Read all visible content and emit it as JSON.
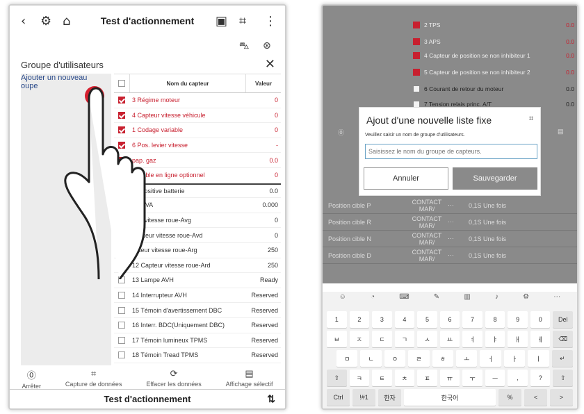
{
  "left_screen": {
    "title": "Test d'actionnement",
    "group_title": "Groupe d'utilisateurs",
    "add_group_link": "Ajouter un nouveau\noupe",
    "table": {
      "col_name": "Nom du capteur",
      "col_value": "Valeur",
      "rows": [
        {
          "name": "3 Régime moteur",
          "value": "0",
          "checked": true
        },
        {
          "name": "4 Capteur vitesse véhicule",
          "value": "0",
          "checked": true
        },
        {
          "name": "1 Codage variable",
          "value": "0",
          "checked": true
        },
        {
          "name": "6 Pos. levier vitesse",
          "value": "-",
          "checked": true
        },
        {
          "name": "pap. gaz",
          "value": "0.0",
          "checked": true
        },
        {
          "name": "variable en ligne optionnel",
          "value": "0",
          "checked": true
        },
        {
          "name": "on positive batterie",
          "value": "0.0",
          "checked": false
        },
        {
          "name": "ion LVA",
          "value": "0.000",
          "checked": false
        },
        {
          "name": "teur vitesse roue-Avg",
          "value": "0",
          "checked": false
        },
        {
          "name": "Capteur vitesse roue-Avd",
          "value": "0",
          "checked": false
        },
        {
          "name": "apteur vitesse roue-Arg",
          "value": "250",
          "checked": false
        },
        {
          "name": "12 Capteur vitesse roue-Ard",
          "value": "250",
          "checked": false
        },
        {
          "name": "13 Lampe AVH",
          "value": "Ready",
          "checked": false
        },
        {
          "name": "14 Interrupteur AVH",
          "value": "Reserved",
          "checked": false
        },
        {
          "name": "15 Témoin d'avertissement DBC",
          "value": "Reserved",
          "checked": false
        },
        {
          "name": "16 Interr. BDC(Uniquement DBC)",
          "value": "Reserved",
          "checked": false
        },
        {
          "name": "17 Témoin lumineux TPMS",
          "value": "Reserved",
          "checked": false
        },
        {
          "name": "18 Témoin Tread TPMS",
          "value": "Reserved",
          "checked": false
        }
      ]
    },
    "tools": [
      {
        "label": "Arrêter",
        "icon": "stop-icon"
      },
      {
        "label": "Capture de données",
        "icon": "capture-icon"
      },
      {
        "label": "Effacer les données",
        "icon": "refresh-icon"
      },
      {
        "label": "Affichage sélectif",
        "icon": "list-icon"
      }
    ],
    "footer_title": "Test d'actionnement"
  },
  "right_screen": {
    "bg_rows": [
      {
        "name": "2 TPS",
        "value": "0.0",
        "checked": true
      },
      {
        "name": "3 APS",
        "value": "0.0",
        "checked": true
      },
      {
        "name": "4 Capteur de position se non inhibiteur 1",
        "value": "0.0",
        "checked": true
      },
      {
        "name": "5 Capteur de position se non inhibiteur 2",
        "value": "0.0",
        "checked": true
      },
      {
        "name": "6 Courant de retour du moteur",
        "value": "0.0",
        "checked": false
      },
      {
        "name": "7 Tension relais princ. A/T",
        "value": "0.0",
        "checked": false
      }
    ],
    "bg_list": [
      {
        "name": "Position cible P",
        "cmd": "CONTACT MAR/",
        "dur": "0,1S Une fois"
      },
      {
        "name": "Position cible R",
        "cmd": "CONTACT MAR/",
        "dur": "0,1S Une fois"
      },
      {
        "name": "Position cible N",
        "cmd": "CONTACT MAR/",
        "dur": "0,1S Une fois"
      },
      {
        "name": "Position cible D",
        "cmd": "CONTACT MAR/",
        "dur": "0,1S Une fois"
      }
    ],
    "modal": {
      "title": "Ajout d'une nouvelle liste fixe",
      "hint": "Veuillez saisir un nom de groupe d'utilisateurs.",
      "placeholder": "Saisissez le nom du groupe de capteurs.",
      "cancel": "Annuler",
      "save": "Sauvegarder"
    },
    "keyboard": {
      "row1": [
        "1",
        "2",
        "3",
        "4",
        "5",
        "6",
        "7",
        "8",
        "9",
        "0",
        "Del"
      ],
      "row2": [
        "ㅂ",
        "ㅈ",
        "ㄷ",
        "ㄱ",
        "ㅅ",
        "ㅛ",
        "ㅕ",
        "ㅑ",
        "ㅐ",
        "ㅔ",
        "⌫"
      ],
      "row3": [
        "ㅁ",
        "ㄴ",
        "ㅇ",
        "ㄹ",
        "ㅎ",
        "ㅗ",
        "ㅓ",
        "ㅏ",
        "ㅣ",
        "↵"
      ],
      "row4": [
        "⇧",
        "ㅋ",
        "ㅌ",
        "ㅊ",
        "ㅍ",
        "ㅠ",
        "ㅜ",
        "ㅡ",
        ",",
        "?",
        "⇧"
      ],
      "row5": [
        "Ctrl",
        "!#1",
        "한자",
        "한국어",
        "%",
        "<",
        ">"
      ]
    }
  }
}
